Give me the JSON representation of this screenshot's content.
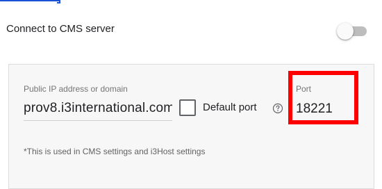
{
  "connect": {
    "label": "Connect to CMS server",
    "toggle_state": "off"
  },
  "server": {
    "ip_label": "Public IP address or domain",
    "ip_value": "prov8.i3international.com",
    "default_port_label": "Default port",
    "default_port_checked": false,
    "help_icon": "help-circle-icon",
    "port_label": "Port",
    "port_value": "18221"
  },
  "note": "*This is used in CMS settings and i3Host settings",
  "colors": {
    "highlight": "#ff0000",
    "panel_bg": "#f7f7f7",
    "toggle_track": "#bdbdbd",
    "link": "#1a4fd6"
  }
}
